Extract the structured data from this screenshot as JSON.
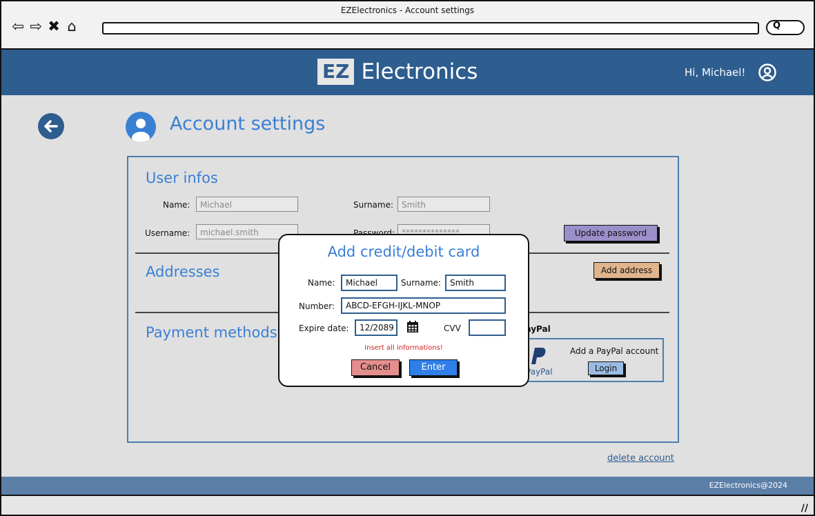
{
  "window": {
    "title": "EZElectronics - Account settings"
  },
  "header": {
    "logo_box": "EZ",
    "logo_text": "Electronics",
    "greeting": "Hi, Michael!"
  },
  "page": {
    "title": "Account settings"
  },
  "user_infos": {
    "title": "User infos",
    "name_label": "Name:",
    "name_value": "Michael",
    "surname_label": "Surname:",
    "surname_value": "Smith",
    "username_label": "Username:",
    "username_value": "michael.smith",
    "password_label": "Password:",
    "password_value": "**************",
    "update_password": "Update password"
  },
  "addresses": {
    "title": "Addresses",
    "add_address": "Add address"
  },
  "payment": {
    "title": "Payment methods",
    "paypal_heading": "PayPal",
    "paypal_logo_text": "PayPal",
    "add_paypal": "Add a PayPal account",
    "login": "Login"
  },
  "modal": {
    "title": "Add credit/debit card",
    "name_label": "Name:",
    "name_value": "Michael",
    "surname_label": "Surname:",
    "surname_value": "Smith",
    "number_label": "Number:",
    "number_value": "ABCD-EFGH-IJKL-MNOP",
    "expire_label": "Expire date:",
    "expire_value": "12/2089",
    "cvv_label": "CVV",
    "cvv_value": "",
    "error": "Insert all informations!",
    "cancel": "Cancel",
    "enter": "Enter"
  },
  "delete_account": "delete account",
  "footer": "EZElectronics@2024",
  "colors": {
    "header": "#2e5d8f",
    "accent_text": "#3a7fd5",
    "update_password_btn": "#9b8fca",
    "add_address_btn": "#e0b48c",
    "login_btn": "#9bbce2",
    "cancel_btn": "#e58e8e",
    "enter_btn": "#2f7fe8",
    "error": "#d32020",
    "footer": "#5c7fa8"
  },
  "icons": [
    "back-arrow-icon",
    "forward-arrow-icon",
    "close-icon",
    "home-icon",
    "search-icon",
    "user-circle-icon",
    "back-circle-icon",
    "account-avatar-icon",
    "calendar-icon",
    "paypal-logo-icon",
    "resize-grip-icon"
  ]
}
